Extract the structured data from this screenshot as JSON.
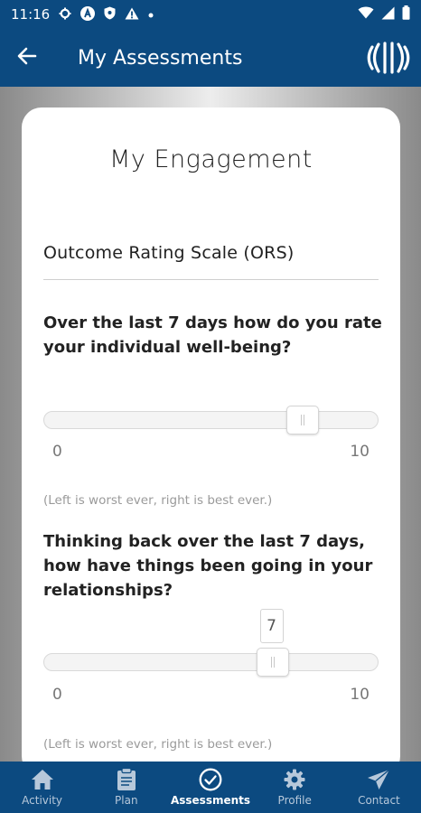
{
  "status_bar": {
    "time": "11:16",
    "left_icons": [
      "gear-icon",
      "a-badge-icon",
      "shield-icon",
      "warning-icon",
      "dot-icon"
    ],
    "right_icons": [
      "wifi-icon",
      "signal-icon",
      "battery-icon"
    ]
  },
  "app_bar": {
    "title": "My Assessments",
    "back_icon": "arrow-left-icon",
    "logo_icon": "wave-logo-icon"
  },
  "card": {
    "title": "My Engagement",
    "section_title": "Outcome Rating Scale (ORS)",
    "questions": [
      {
        "text": "Over the last 7 days how do you rate your individual well-being?",
        "min_label": "0",
        "max_label": "10",
        "value": 8,
        "hint": "(Left is worst ever, right is best ever.)"
      },
      {
        "text": "Thinking back over the last 7 days, how have things been going in your relationships?",
        "min_label": "0",
        "max_label": "10",
        "value": 7,
        "value_label": "7",
        "hint": "(Left is worst ever, right is best ever.)"
      }
    ]
  },
  "bottom_nav": {
    "items": [
      {
        "label": "Activity",
        "icon": "home-icon",
        "active": false
      },
      {
        "label": "Plan",
        "icon": "clipboard-icon",
        "active": false
      },
      {
        "label": "Assessments",
        "icon": "check-circle-icon",
        "active": true
      },
      {
        "label": "Profile",
        "icon": "gear-icon",
        "active": false
      },
      {
        "label": "Contact",
        "icon": "send-icon",
        "active": false
      }
    ]
  },
  "colors": {
    "brand": "#0c4a80",
    "nav_inactive": "#b7c8da",
    "card_bg": "#ffffff"
  }
}
